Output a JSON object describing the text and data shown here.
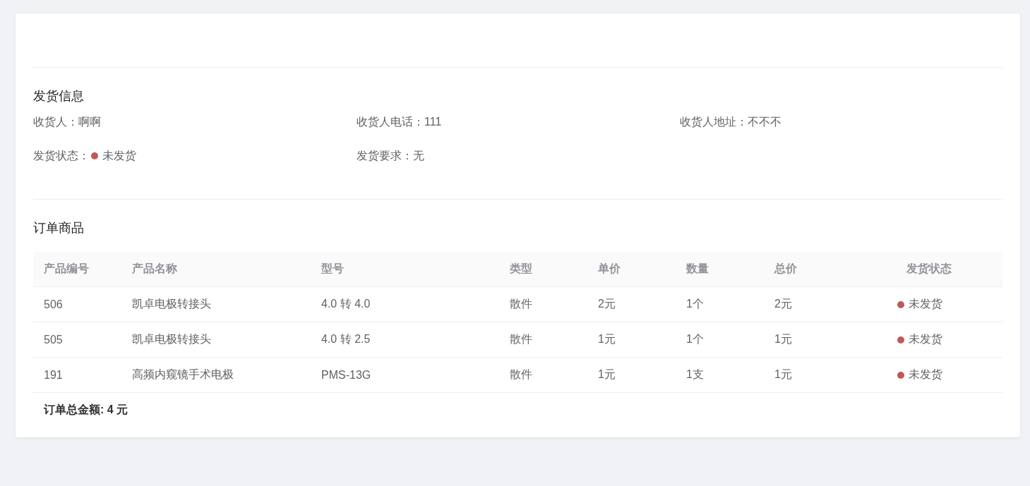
{
  "shipping_info": {
    "title": "发货信息",
    "fields": [
      {
        "kind": "text",
        "label": "收货人：",
        "value": "啊啊"
      },
      {
        "kind": "text",
        "label": "收货人电话：",
        "value": "111"
      },
      {
        "kind": "text",
        "label": "收货人地址：",
        "value": "不不不"
      },
      {
        "kind": "status",
        "label": "发货状态：",
        "value": "未发货",
        "color": "#c45656"
      },
      {
        "kind": "text",
        "label": "发货要求：",
        "value": "无"
      }
    ]
  },
  "order_items": {
    "title": "订单商品",
    "table": {
      "columns": [
        "产品编号",
        "产品名称",
        "型号",
        "类型",
        "单价",
        "数量",
        "总价",
        "发货状态"
      ],
      "rows": [
        {
          "cells": [
            "506",
            "凯卓电极转接头",
            "4.0 转 4.0",
            "散件",
            "2元",
            "1个",
            "2元"
          ],
          "status": "未发货",
          "color": "#c45656"
        },
        {
          "cells": [
            "505",
            "凯卓电极转接头",
            "4.0 转 2.5",
            "散件",
            "1元",
            "1个",
            "1元"
          ],
          "status": "未发货",
          "color": "#c45656"
        },
        {
          "cells": [
            "191",
            "高频内窥镜手术电极",
            "PMS-13G",
            "散件",
            "1元",
            "1支",
            "1元"
          ],
          "status": "未发货",
          "color": "#c45656"
        }
      ]
    },
    "total": "订单总金额: 4 元"
  }
}
